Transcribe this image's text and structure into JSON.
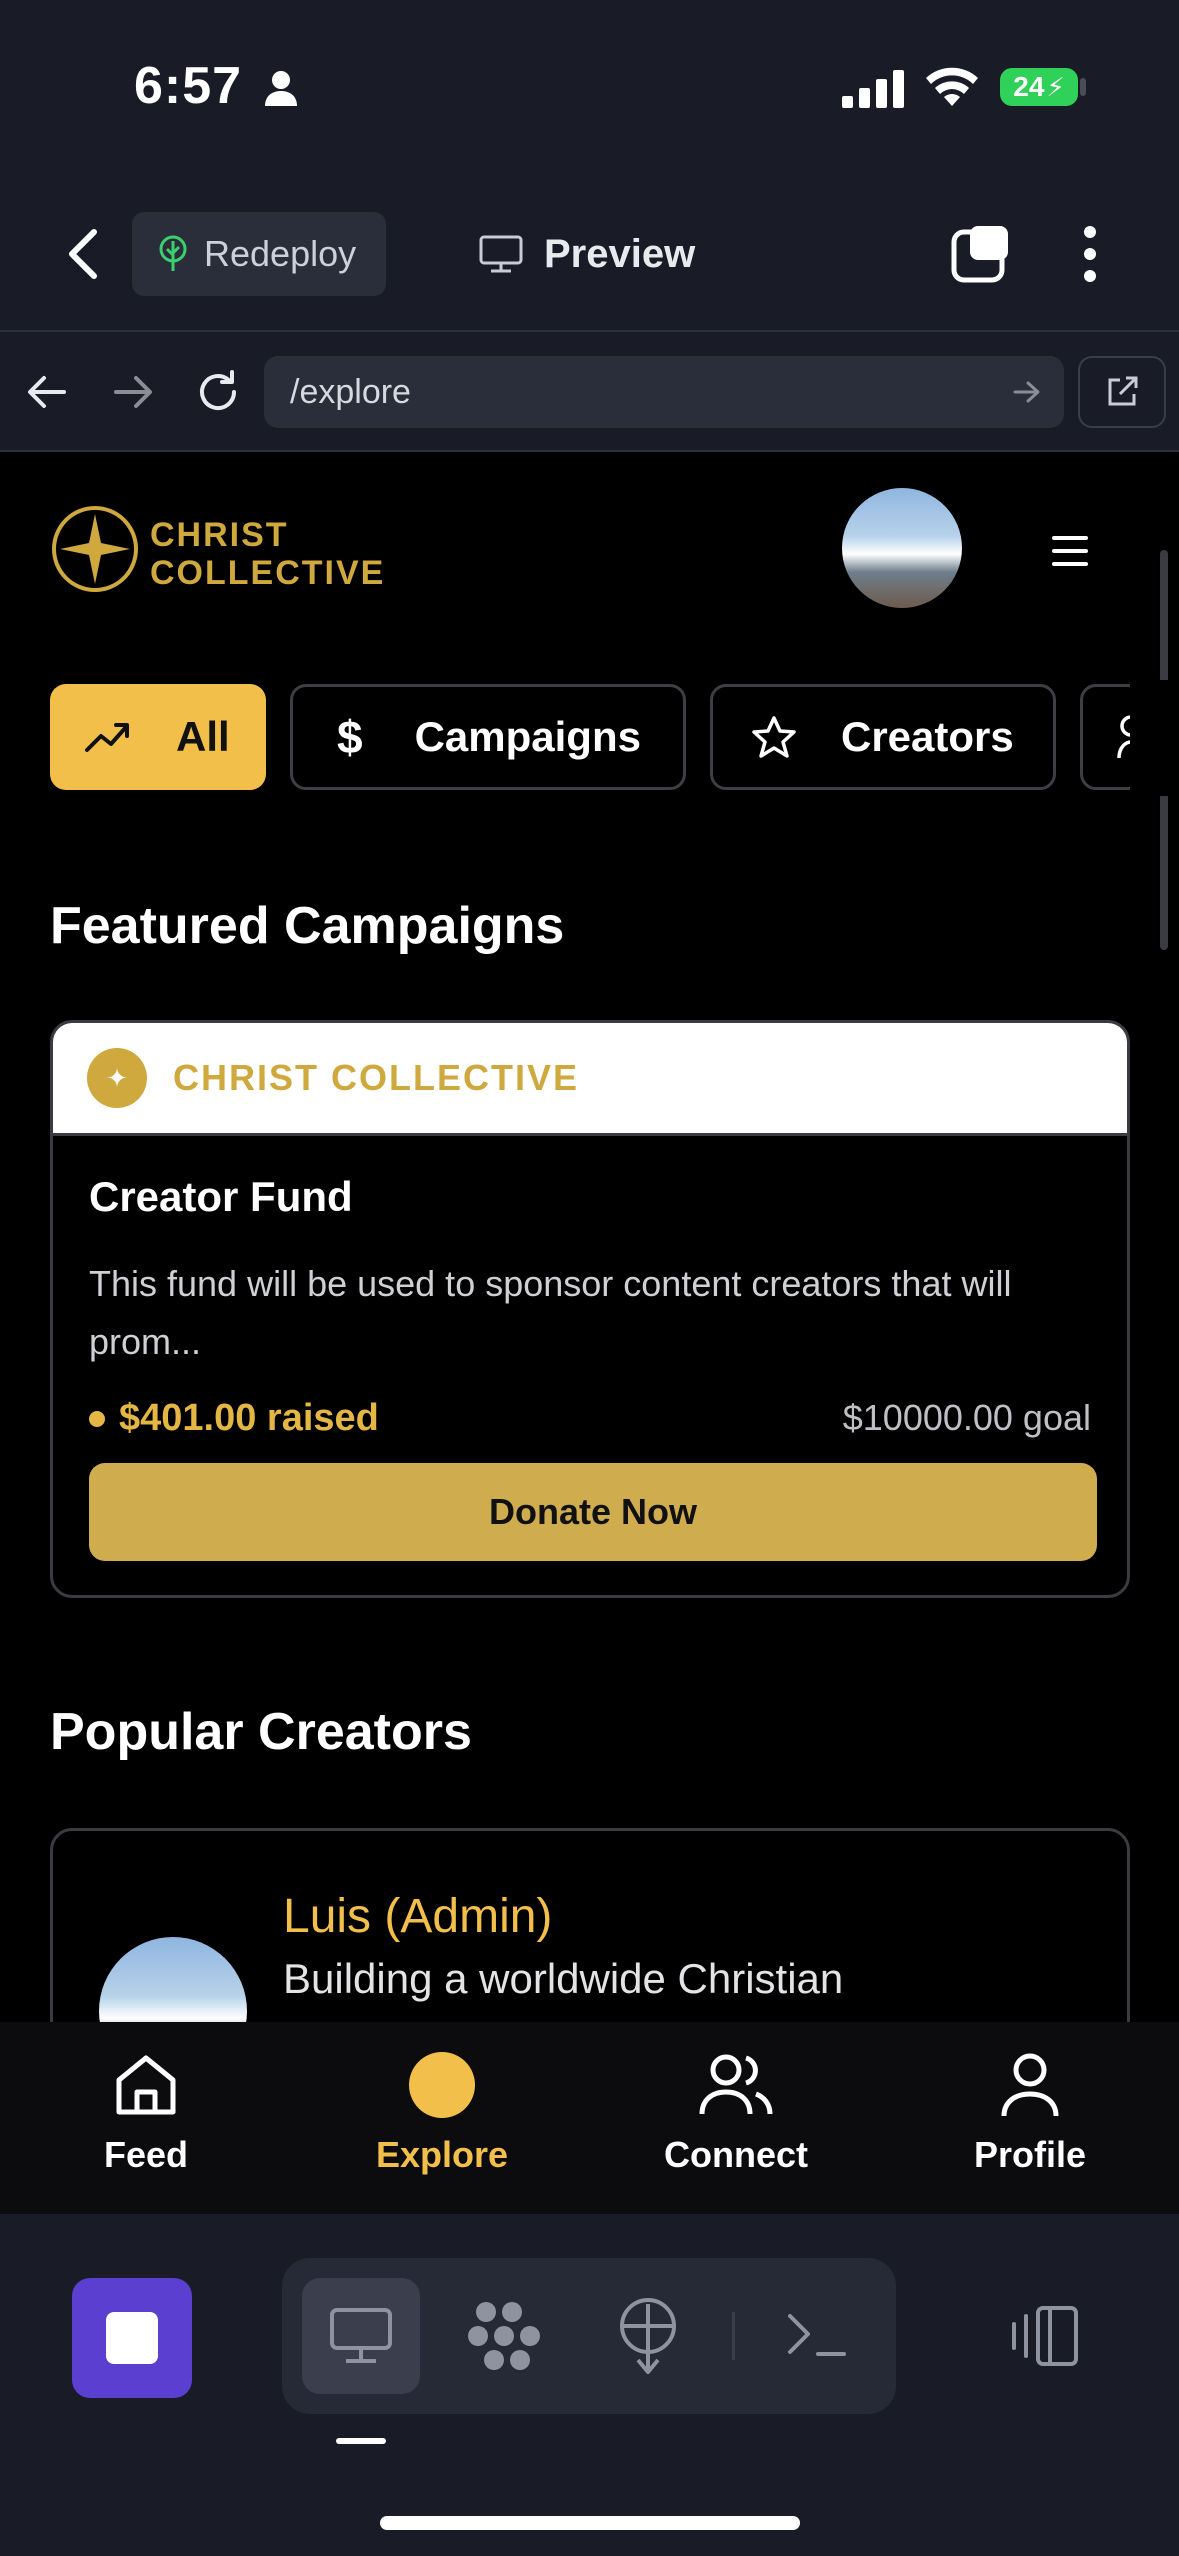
{
  "status_bar": {
    "time": "6:57",
    "battery": "24"
  },
  "browser": {
    "redeploy_label": "Redeploy",
    "preview_label": "Preview",
    "url": "/explore"
  },
  "app": {
    "logo": {
      "line1": "CHRIST",
      "line2": "COLLECTIVE"
    },
    "filters": [
      {
        "label": "All",
        "icon": "trending-icon",
        "active": true
      },
      {
        "label": "Campaigns",
        "icon": "dollar-icon",
        "active": false
      },
      {
        "label": "Creators",
        "icon": "star-icon",
        "active": false
      }
    ],
    "featured_title": "Featured Campaigns",
    "campaign": {
      "org": "CHRIST COLLECTIVE",
      "title": "Creator Fund",
      "description": "This fund will be used to sponsor content creators that will prom...",
      "raised": "$401.00 raised",
      "goal": "$10000.00 goal",
      "donate_label": "Donate Now"
    },
    "popular_title": "Popular Creators",
    "creator": {
      "name": "Luis (Admin)",
      "bio": "Building a worldwide Christian"
    },
    "tabs": [
      {
        "label": "Feed"
      },
      {
        "label": "Explore"
      },
      {
        "label": "Connect"
      },
      {
        "label": "Profile"
      }
    ]
  },
  "colors": {
    "accent": "#f2c04a",
    "gold": "#cfa83e",
    "chrome": "#191c27"
  }
}
